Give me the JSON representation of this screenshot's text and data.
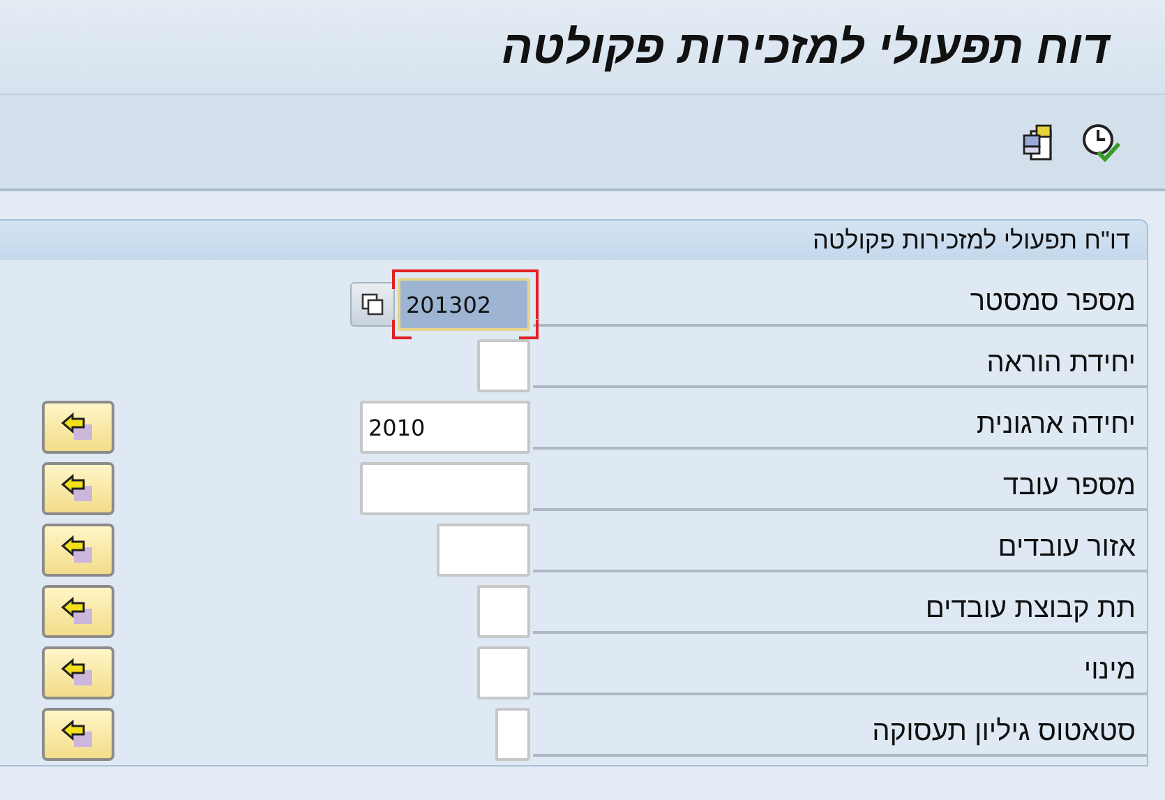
{
  "window": {
    "title": "דוח תפעולי למזכירות פקולטה"
  },
  "toolbar": {
    "buttons": [
      {
        "kind": "execute"
      },
      {
        "kind": "variants"
      }
    ]
  },
  "group": {
    "title": "דו\"ח תפעולי למזכירות פקולטה",
    "fields": [
      {
        "label": "מספר סמסטר",
        "value": "201302",
        "kind": "long",
        "focused": true,
        "copy_button": true,
        "multiple_selection": false
      },
      {
        "label": "יחידת הוראה",
        "kind": "narrow",
        "focused": false,
        "copy_button": false,
        "multiple_selection": false
      },
      {
        "label": "יחידה ארגונית",
        "value": "2010",
        "kind": "wide",
        "focused": false,
        "copy_button": false,
        "multiple_selection": true
      },
      {
        "label": "מספר עובד",
        "kind": "wide",
        "focused": false,
        "copy_button": false,
        "multiple_selection": true
      },
      {
        "label": "אזור עובדים",
        "kind": "medium",
        "focused": false,
        "copy_button": false,
        "multiple_selection": true
      },
      {
        "label": "תת קבוצת עובדים",
        "kind": "narrow",
        "focused": false,
        "copy_button": false,
        "multiple_selection": true
      },
      {
        "label": "מינוי",
        "kind": "narrow",
        "focused": false,
        "copy_button": false,
        "multiple_selection": true
      },
      {
        "label": "סטאטוס גיליון תעסוקה",
        "kind": "tiny",
        "focused": false,
        "copy_button": false,
        "multiple_selection": true
      }
    ]
  }
}
